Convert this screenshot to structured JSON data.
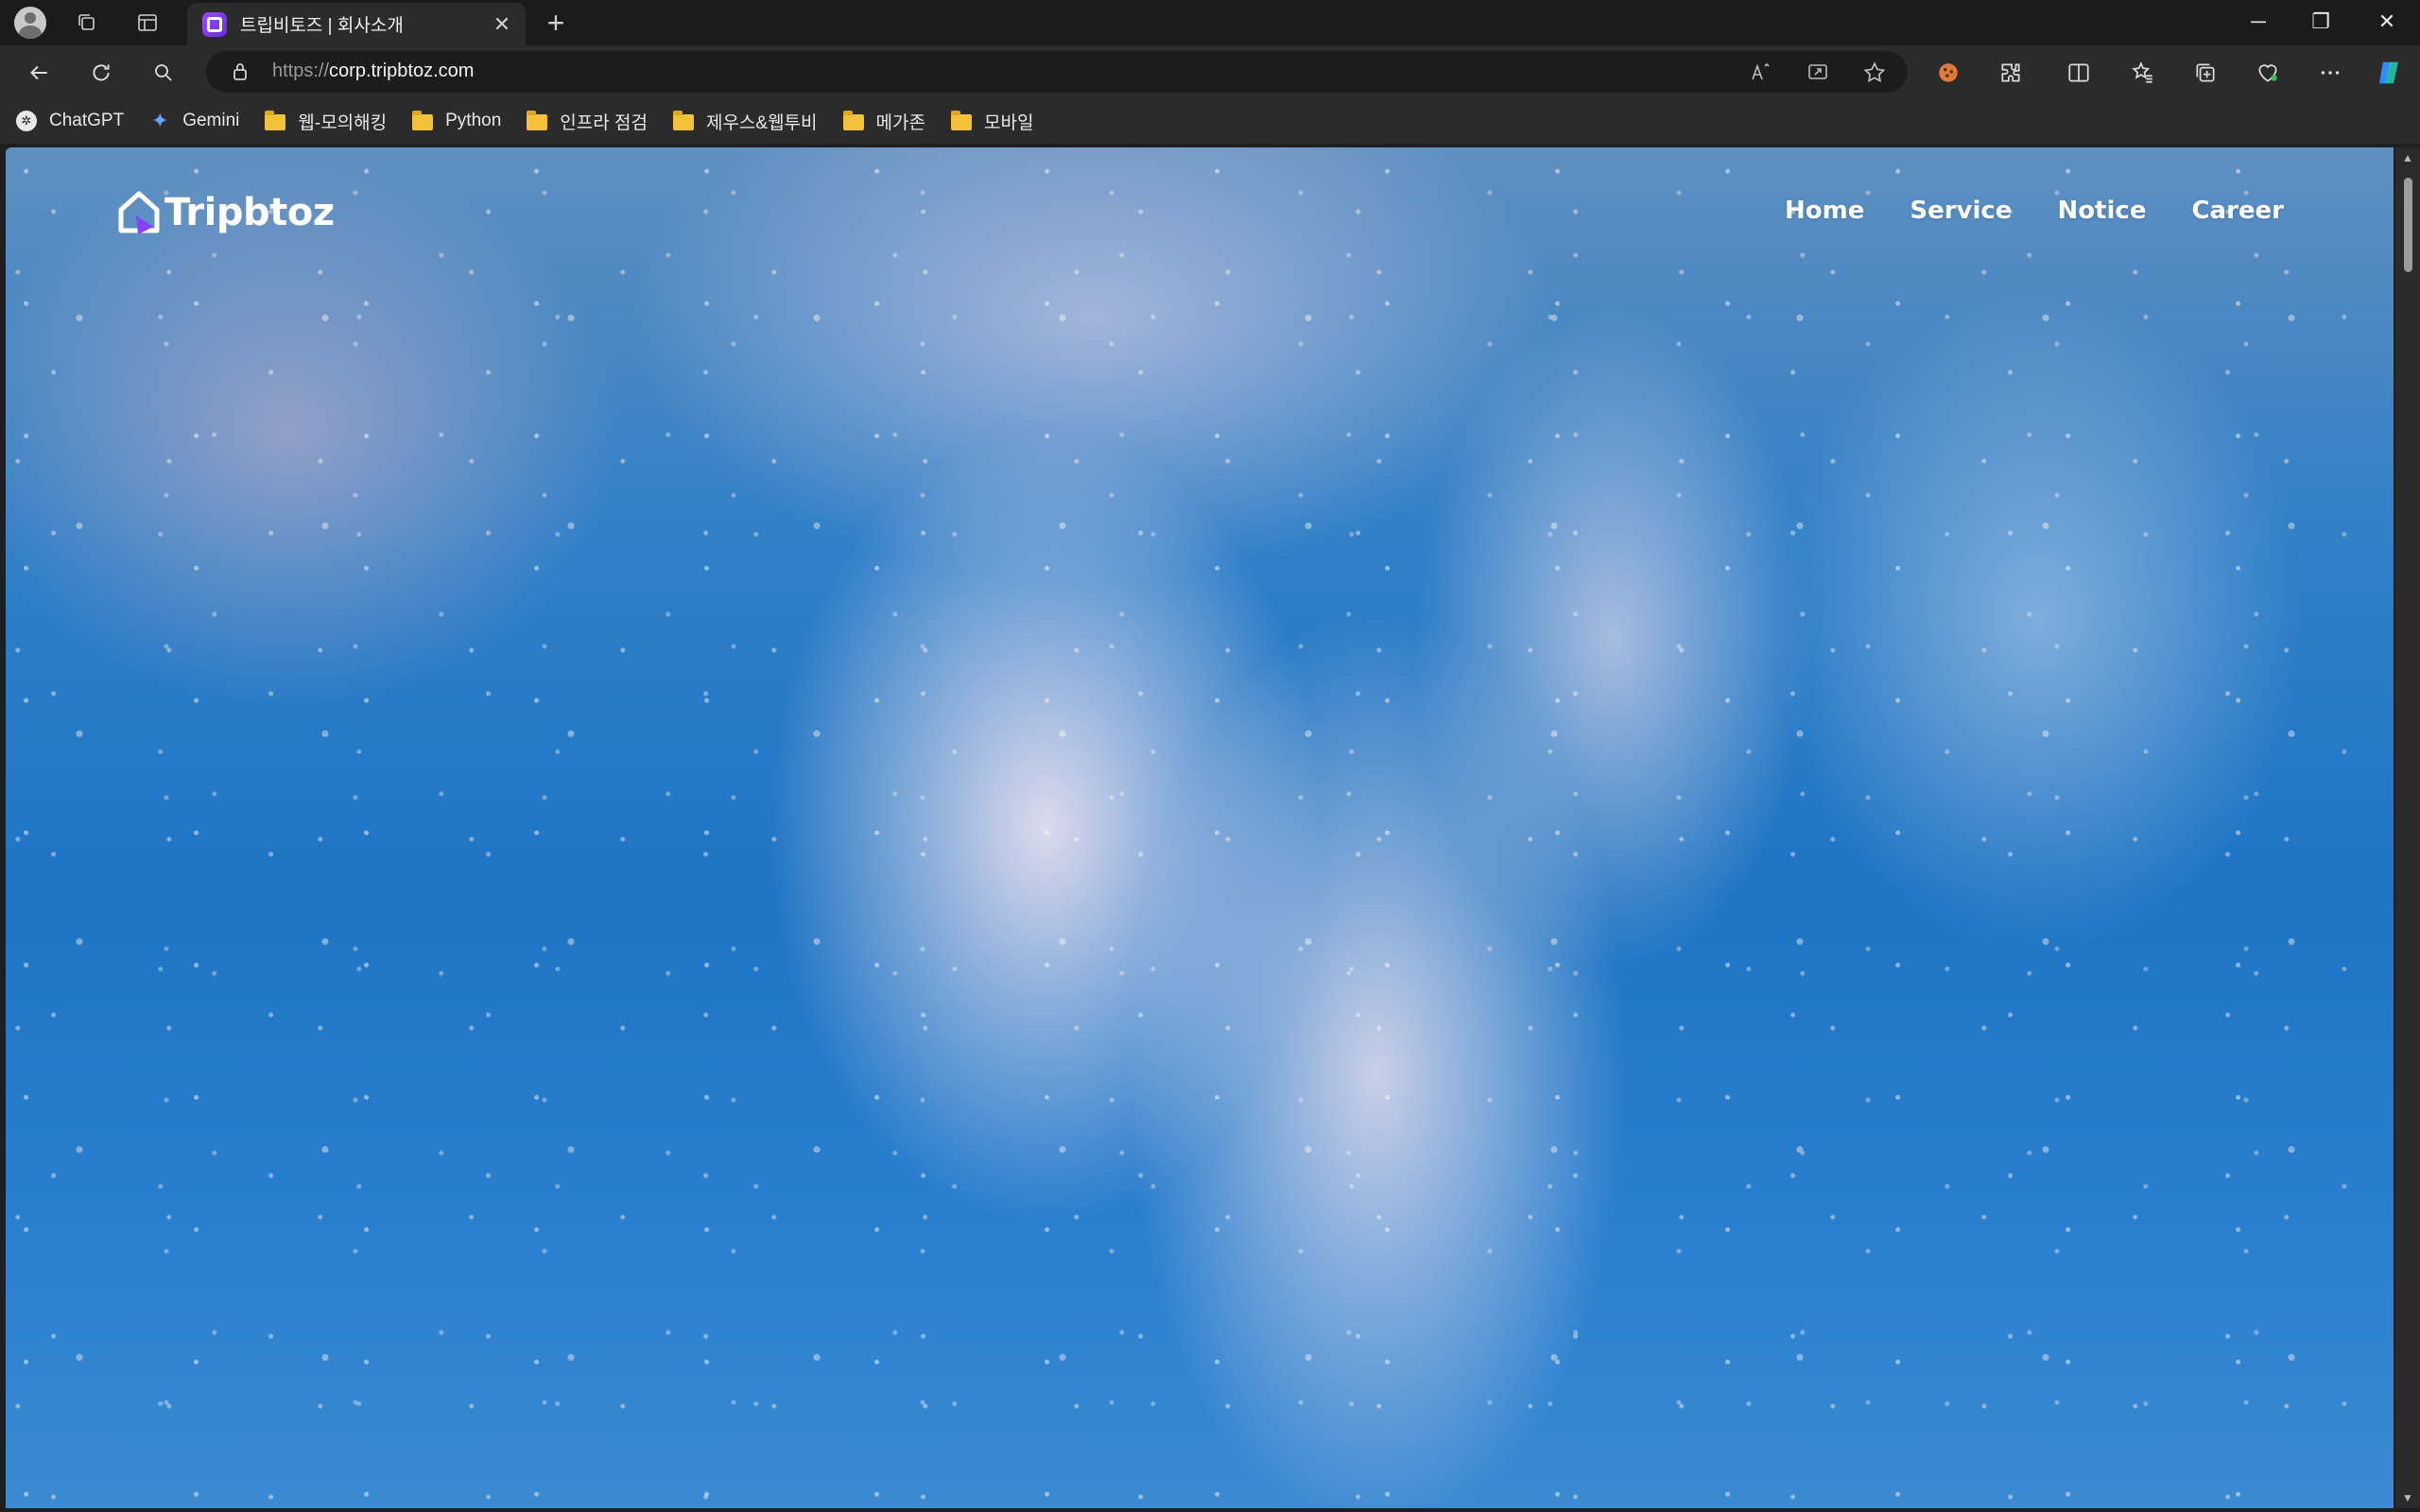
{
  "browser": {
    "tab": {
      "title": "트립비토즈 | 회사소개",
      "close": "✕"
    },
    "new_tab": "+",
    "window": {
      "minimize": "─",
      "restore": "❐",
      "close": "✕"
    },
    "address": {
      "protocol": "https://",
      "host": "corp.tripbtoz.com"
    },
    "bookmarks": [
      {
        "label": "ChatGPT",
        "icon": "chatgpt-icon"
      },
      {
        "label": "Gemini",
        "icon": "gemini-icon"
      },
      {
        "label": "웹-모의해킹",
        "icon": "folder-icon"
      },
      {
        "label": "Python",
        "icon": "folder-icon"
      },
      {
        "label": "인프라 점검",
        "icon": "folder-icon"
      },
      {
        "label": "제우스&웹투비",
        "icon": "folder-icon"
      },
      {
        "label": "메가존",
        "icon": "folder-icon"
      },
      {
        "label": "모바일",
        "icon": "folder-icon"
      }
    ]
  },
  "site": {
    "logo_text": "Tripbtoz",
    "nav": [
      "Home",
      "Service",
      "Notice",
      "Career"
    ],
    "accent": "#8a3ffc"
  }
}
